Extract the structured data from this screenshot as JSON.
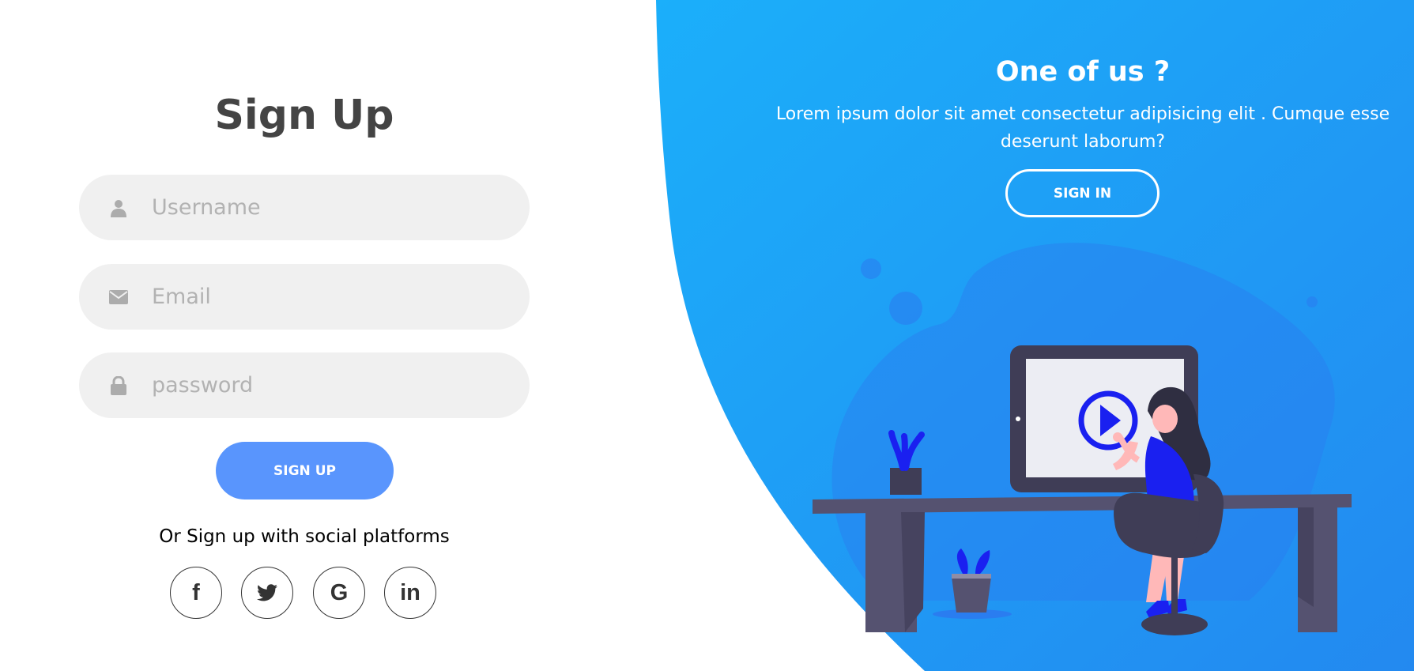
{
  "signup_form": {
    "title": "Sign Up",
    "username_placeholder": "Username",
    "email_placeholder": "Email",
    "password_placeholder": "password",
    "submit_label": "SIGN UP",
    "social_text": "Or Sign up with social platforms",
    "social_platforms": [
      {
        "name": "facebook",
        "icon": "facebook-icon",
        "glyph": "f"
      },
      {
        "name": "twitter",
        "icon": "twitter-icon",
        "glyph": ""
      },
      {
        "name": "google",
        "icon": "google-icon",
        "glyph": "G"
      },
      {
        "name": "linkedin",
        "icon": "linkedin-icon",
        "glyph": "in"
      }
    ]
  },
  "panel": {
    "heading": "One of us ?",
    "text": "Lorem ipsum dolor sit amet consectetur adipisicing elit . Cumque esse deserunt laborum?",
    "button_label": "SIGN IN"
  },
  "icons": {
    "username": "user-icon",
    "email": "envelope-icon",
    "password": "lock-icon"
  },
  "colors": {
    "accent": "#5995fd",
    "panel_gradient_start": "#1ba9fa",
    "panel_gradient_end": "#2a8ef0",
    "input_background": "#f0f0f0",
    "placeholder": "#b2b2b2",
    "heading": "#444444"
  }
}
